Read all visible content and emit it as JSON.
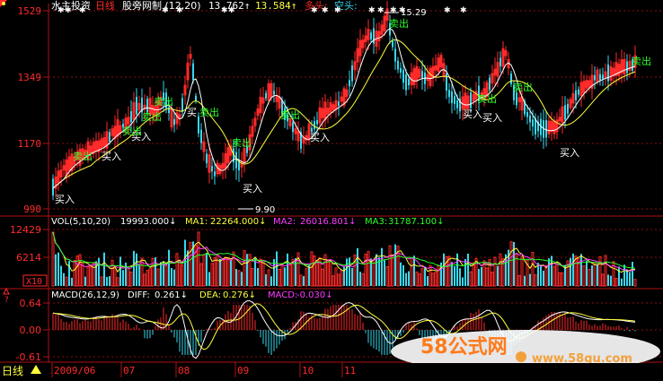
{
  "header": {
    "title": "水主投资",
    "period": "日线",
    "indicator": "股旁网制 (12,20)",
    "v1": "13.762↑",
    "v2": "13.584↑",
    "long_label": "多头:",
    "short_label": "空头:"
  },
  "price_axis": {
    "labels": [
      "1529",
      "1349",
      "1170",
      "990"
    ]
  },
  "price_notes": {
    "high": "15.29",
    "low": "9.90"
  },
  "trade_signals": {
    "buy_label": "买入",
    "sell_label": "卖出",
    "buys": [
      "买入",
      "买入",
      "买入",
      "买入",
      "买入",
      "买入",
      "买入",
      "买入"
    ],
    "sells": [
      "卖出",
      "卖出",
      "卖出",
      "卖出",
      "卖出",
      "卖出",
      "卖出",
      "卖出",
      "卖出",
      "卖出"
    ]
  },
  "vol_header": {
    "name": "VOL(5,10,20)",
    "value": "19993.000↓",
    "ma1_label": "MA1:",
    "ma1": "22264.000↓",
    "ma2_label": "MA2:",
    "ma2": "26016.801↓",
    "ma3_label": "MA3:",
    "ma3": "31787.100↓"
  },
  "vol_axis": {
    "labels": [
      "12429",
      "6214",
      "X10"
    ]
  },
  "macd_header": {
    "name": "MACD(26,12,9)",
    "diff_label": "DIFF:",
    "diff": "0.261↓",
    "dea_label": "DEA:",
    "dea": "0.276↓",
    "macd_label": "MACD:",
    "macd": "-0.030↓"
  },
  "macd_axis": {
    "labels": [
      "0.64",
      "0.00",
      "-0.61"
    ]
  },
  "footer": {
    "period_button": "日线",
    "dates": [
      "2009/06",
      "07",
      "08",
      "09",
      "10",
      "11"
    ]
  },
  "watermark": {
    "brand": "58公式网",
    "url": "www.58gu.com"
  },
  "colors": {
    "up": "#ff2a2a",
    "down": "#36d8ee",
    "ma_yellow": "#ffff3c",
    "ma_white": "#ffffff",
    "ma_magenta": "#ff3cff",
    "ma_green": "#2aff2a",
    "grid_red": "#b01010",
    "sell_text": "#2aff2a",
    "buy_text": "#ffffff"
  },
  "icons": [
    "corner-marker-icon",
    "triangle-warning-icon",
    "star-marker-icon"
  ]
}
